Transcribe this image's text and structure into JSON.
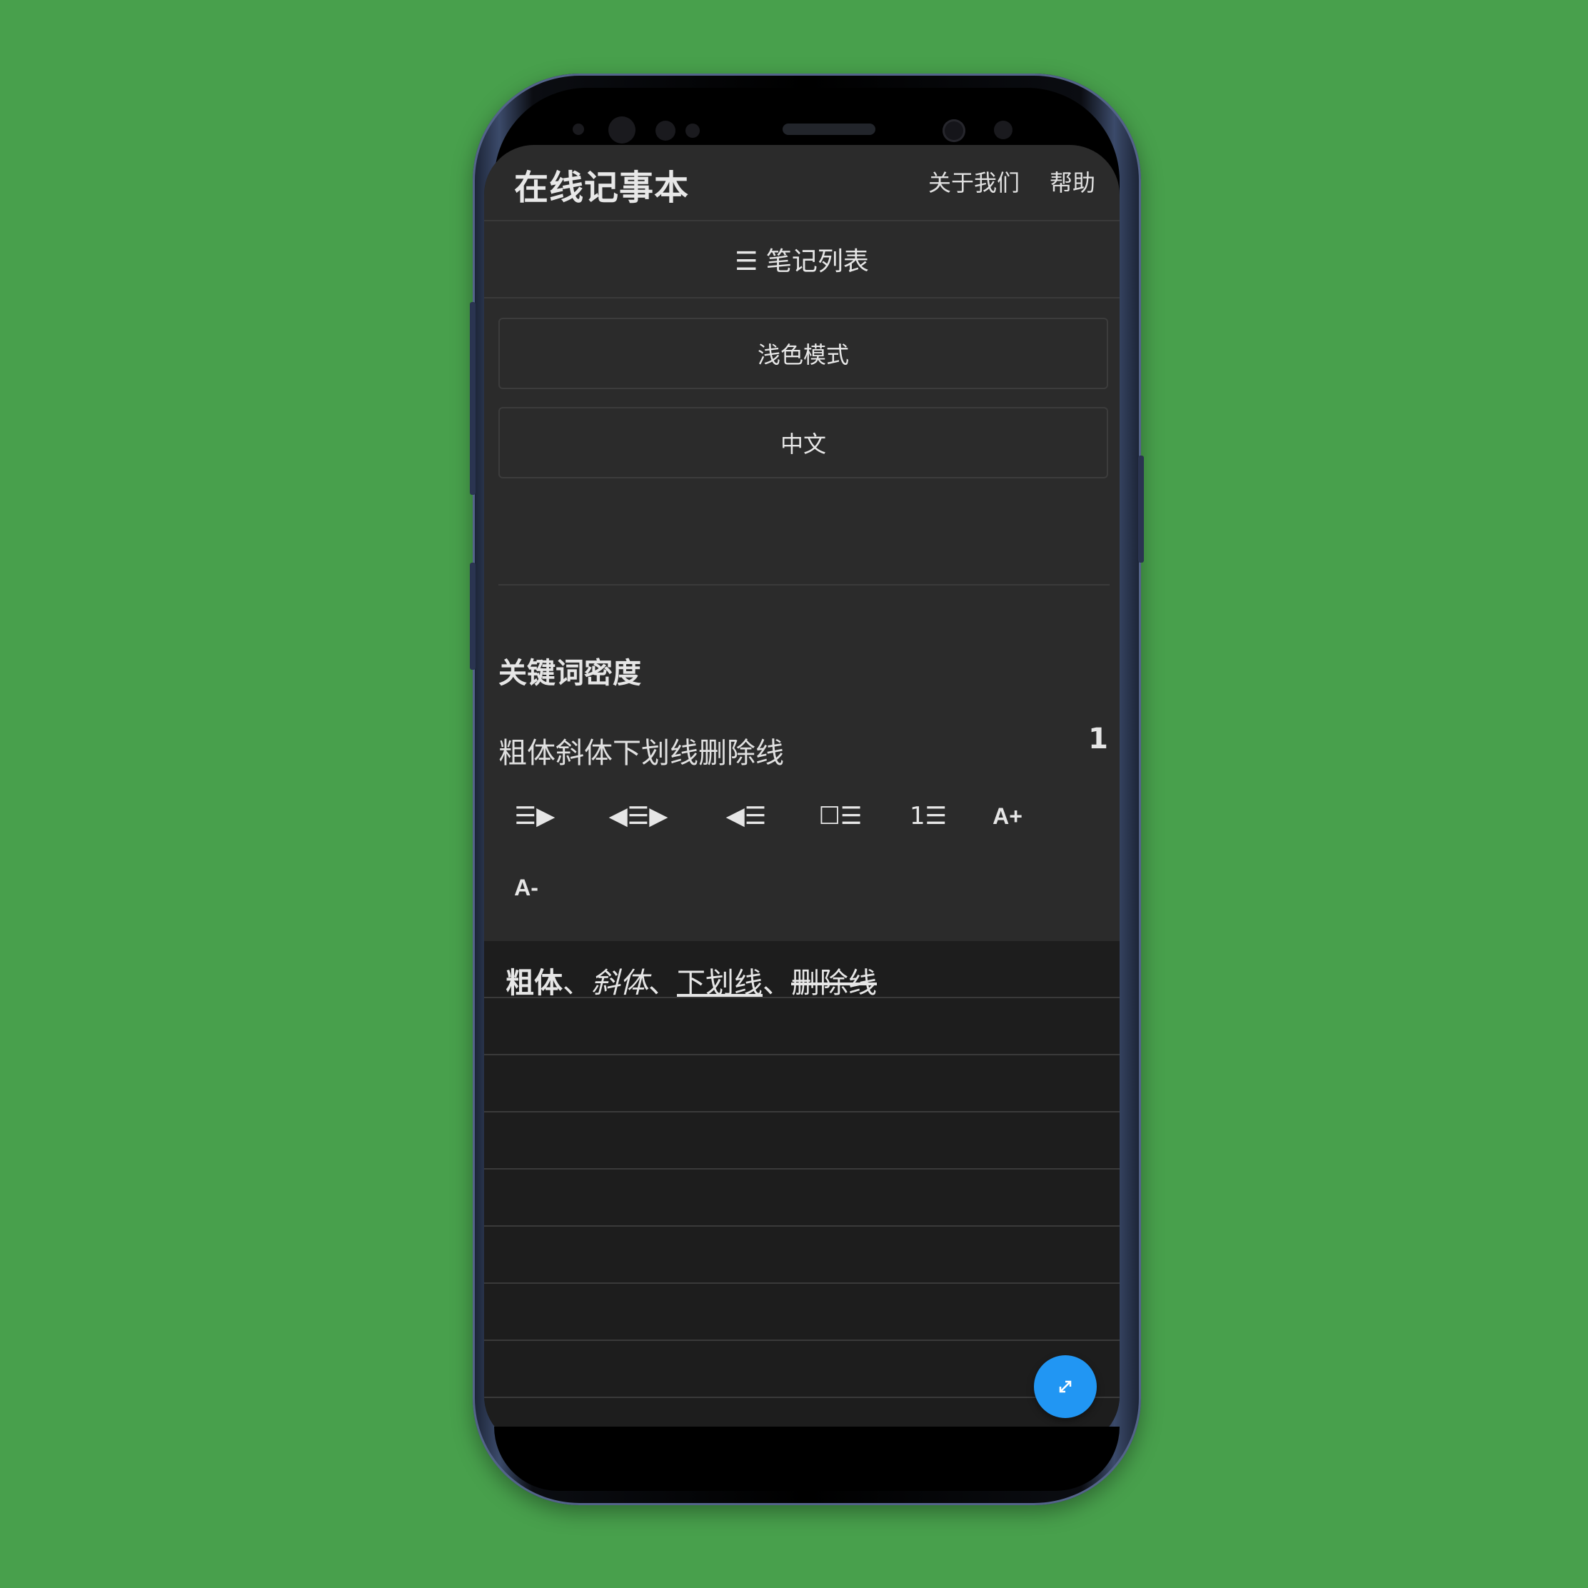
{
  "app": {
    "title": "在线记事本"
  },
  "nav": {
    "about": "关于我们",
    "help": "帮助"
  },
  "notes_list": {
    "label": "☰ 笔记列表"
  },
  "settings": {
    "theme_button": "浅色模式",
    "language_button": "中文"
  },
  "keyword_density": {
    "title": "关键词密度",
    "word": "粗体斜体下划线删除线",
    "count": "1"
  },
  "toolbar": {
    "align_right": "☰▶",
    "align_center": "◀☰▶",
    "align_left": "◀☰",
    "checklist": "☐☰",
    "numbered_list": "1☰",
    "font_increase": "A+",
    "font_decrease": "A-"
  },
  "editor": {
    "bold": "粗体",
    "sep1": "、",
    "italic": "斜体",
    "sep2": "、",
    "underline": "下划线",
    "sep3": "、",
    "strike": "删除线"
  },
  "fab": {
    "icon": "expand-arrows-icon",
    "color": "#2196f3"
  },
  "colors": {
    "background": "#48a04c",
    "surface": "#2b2b2b",
    "editor": "#1d1d1d",
    "text": "#e6e6e6"
  }
}
